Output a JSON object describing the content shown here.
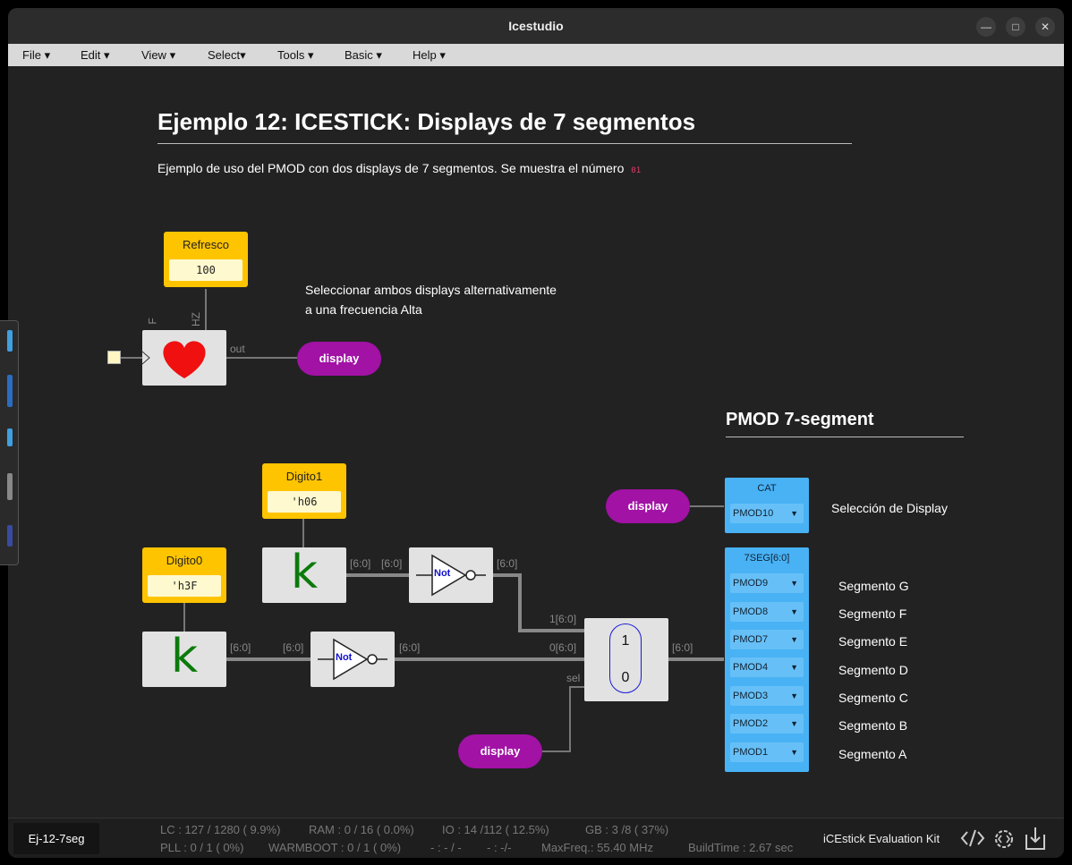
{
  "window": {
    "title": "Icestudio"
  },
  "menu": [
    "File",
    "Edit",
    "View",
    "Select",
    "Tools",
    "Basic",
    "Help"
  ],
  "header": {
    "title": "Ejemplo 12: ICESTICK: Displays de 7 segmentos",
    "desc": "Ejemplo de uso del PMOD con dos displays de 7 segmentos. Se muestra el número",
    "code": "01"
  },
  "note": {
    "line1": "Seleccionar ambos displays alternativamente",
    "line2": "a una frecuencia Alta"
  },
  "pmod_section": {
    "title": "PMOD 7-segment"
  },
  "refresco": {
    "label": "Refresco",
    "value": "100"
  },
  "heart": {
    "port_f": "F",
    "port_hz": "HZ",
    "port_out": "out"
  },
  "digito1": {
    "label": "Digito1",
    "value": "'h06",
    "k": "k"
  },
  "digito0": {
    "label": "Digito0",
    "value": "'h3F",
    "k": "k"
  },
  "not_gate": {
    "label": "Not"
  },
  "mux": {
    "top": "1",
    "bottom": "0",
    "in1": "1[6:0]",
    "in0": "0[6:0]",
    "sel": "sel",
    "out": "[6:0]"
  },
  "wires": {
    "bus": "[6:0]"
  },
  "labels": {
    "display": "display"
  },
  "cat": {
    "title": "CAT",
    "pin": "PMOD10",
    "desc": "Selección de Display"
  },
  "seg": {
    "title": "7SEG[6:0]",
    "pins": [
      {
        "pin": "PMOD9",
        "label": "Segmento G"
      },
      {
        "pin": "PMOD8",
        "label": "Segmento F"
      },
      {
        "pin": "PMOD7",
        "label": "Segmento E"
      },
      {
        "pin": "PMOD4",
        "label": "Segmento D"
      },
      {
        "pin": "PMOD3",
        "label": "Segmento C"
      },
      {
        "pin": "PMOD2",
        "label": "Segmento B"
      },
      {
        "pin": "PMOD1",
        "label": "Segmento A"
      }
    ]
  },
  "status": {
    "file": "Ej-12-7seg",
    "lc": "LC : 127 / 1280 ( 9.9%)",
    "ram": "RAM : 0 / 16 ( 0.0%)",
    "io": "IO :  14 /112  ( 12.5%)",
    "gb": "GB :  3 /8  ( 37%)",
    "pll": "PLL : 0 / 1 ( 0%)",
    "warmboot": "WARMBOOT : 0 / 1 ( 0%)",
    "blank1": "- : - / -",
    "blank2": "- :  -/-",
    "maxfreq": "MaxFreq.:  55.40 MHz",
    "buildtime": "BuildTime :  2.67 sec",
    "board": "iCEstick Evaluation Kit"
  }
}
